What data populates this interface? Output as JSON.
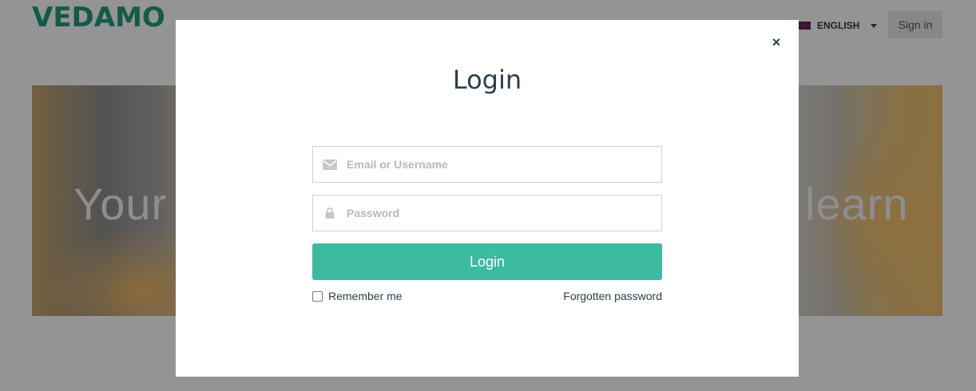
{
  "header": {
    "logo_text": "VEDAMO",
    "language": "ENGLISH",
    "signin_label": "Sign in"
  },
  "hero": {
    "text_left": "Your",
    "text_right": "learn"
  },
  "modal": {
    "title": "Login",
    "close_label": "×",
    "email_placeholder": "Email or Username",
    "password_placeholder": "Password",
    "login_label": "Login",
    "remember_label": "Remember me",
    "forgot_label": "Forgotten password",
    "remember_checked": false
  },
  "colors": {
    "brand": "#1f9e7c",
    "button": "#3cbba1",
    "title": "#2c3e50"
  },
  "icons": {
    "email": "envelope-icon",
    "password": "lock-icon",
    "close": "close-icon",
    "language": "uk-flag-icon",
    "dropdown": "caret-down-icon"
  }
}
